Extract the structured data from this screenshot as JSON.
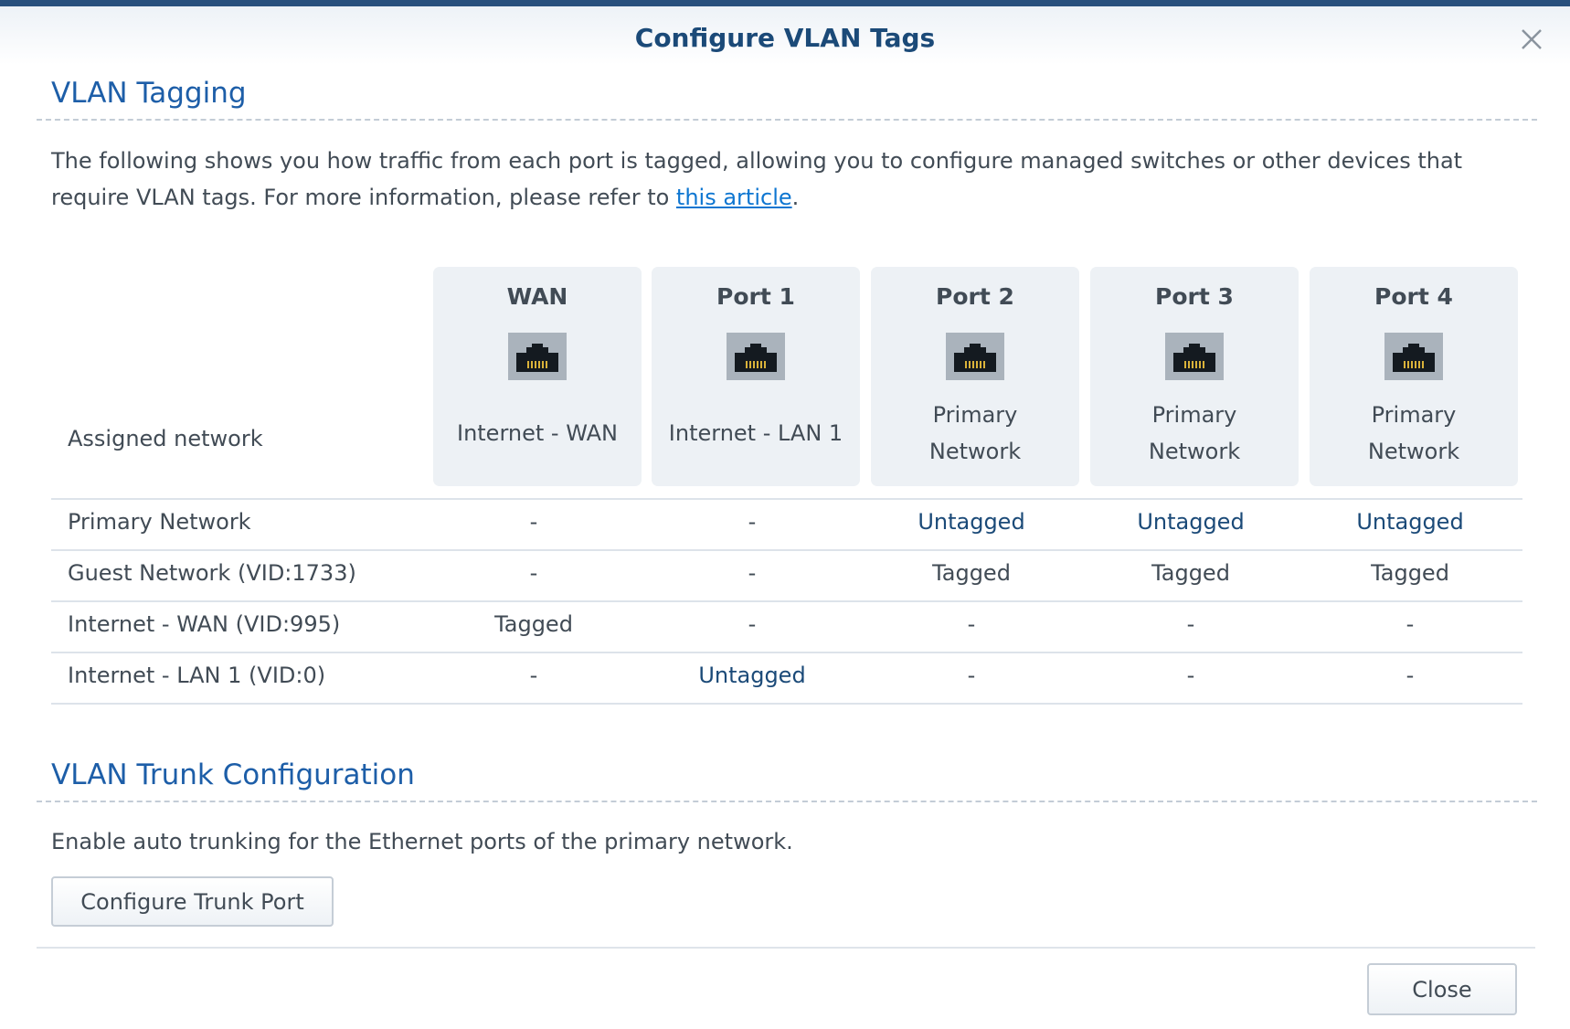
{
  "dialog": {
    "title": "Configure VLAN Tags"
  },
  "vlan_tagging": {
    "title": "VLAN Tagging",
    "desc_before": "The following shows you how traffic from each port is tagged, allowing you to configure managed switches or other devices that require VLAN tags. For more information, please refer to ",
    "link_text": "this article",
    "desc_after": "."
  },
  "table": {
    "assigned_label": "Assigned network",
    "ports": [
      {
        "name": "WAN",
        "network": "Internet - WAN"
      },
      {
        "name": "Port 1",
        "network": "Internet - LAN 1"
      },
      {
        "name": "Port 2",
        "network": "Primary Network"
      },
      {
        "name": "Port 3",
        "network": "Primary Network"
      },
      {
        "name": "Port 4",
        "network": "Primary Network"
      }
    ],
    "rows": [
      {
        "label": "Primary Network",
        "cells": [
          "-",
          "-",
          "Untagged",
          "Untagged",
          "Untagged"
        ]
      },
      {
        "label": "Guest Network (VID:1733)",
        "cells": [
          "-",
          "-",
          "Tagged",
          "Tagged",
          "Tagged"
        ]
      },
      {
        "label": "Internet - WAN (VID:995)",
        "cells": [
          "Tagged",
          "-",
          "-",
          "-",
          "-"
        ]
      },
      {
        "label": "Internet - LAN 1 (VID:0)",
        "cells": [
          "-",
          "Untagged",
          "-",
          "-",
          "-"
        ]
      }
    ]
  },
  "trunk": {
    "title": "VLAN Trunk Configuration",
    "desc": "Enable auto trunking for the Ethernet ports of the primary network.",
    "button_label": "Configure Trunk Port"
  },
  "footer": {
    "close_label": "Close"
  },
  "icons": {
    "close": "close-x-icon",
    "port": "ethernet-port-icon"
  },
  "colors": {
    "accent": "#1d5ea8",
    "title": "#1b4a78",
    "link": "#0e76d1",
    "topbar": "#28507d"
  }
}
